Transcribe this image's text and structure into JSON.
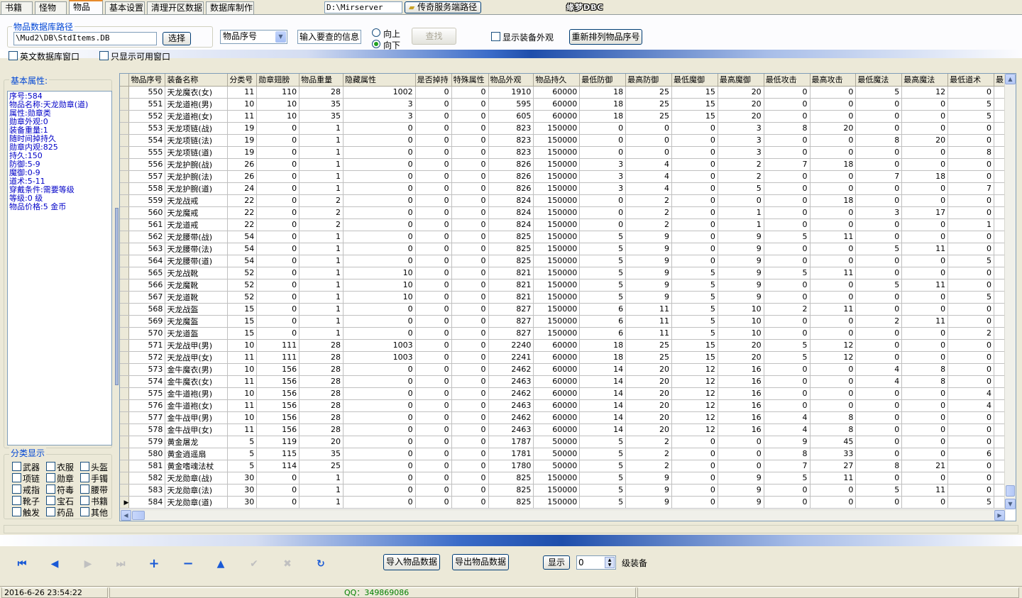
{
  "tabs": [
    "书籍",
    "怪物",
    "物品",
    "基本设置",
    "清理开区数据",
    "数据库制作"
  ],
  "active_tab": 2,
  "server_path": "D:\\Mirserver",
  "server_path_button": "传奇服务端路径",
  "logo_text": "缘梦DBC",
  "db_group_title": "物品数据库路径",
  "db_path": "\\Mud2\\DB\\StdItems.DB",
  "select_button": "选择",
  "search_field_select": "物品序号",
  "search_input_label": "输入要查的信息",
  "radio_up": "向上",
  "radio_down": "向下",
  "find_button": "查找",
  "show_appearance_label": "显示装备外观",
  "reorder_button": "重新排列物品序号",
  "english_db_label": "英文数据库窗口",
  "only_usable_label": "只显示可用窗口",
  "basic_props_title": "基本属性:",
  "props": [
    "序号:584",
    "物品名称:天龙勋章(道)",
    "属性:勋章类",
    "勋章外观:0",
    "装备重量:1",
    "随时间掉持久",
    "勋章内观:825",
    "持久:150",
    "防御:5-9",
    "魔御:0-9",
    "道术:5-11",
    "穿戴条件:需要等级",
    "等级:0 级",
    "物品价格:5 金币"
  ],
  "category_title": "分类显示",
  "categories": [
    "武器",
    "衣服",
    "头盔",
    "项链",
    "勋章",
    "手镯",
    "戒指",
    "符毒",
    "腰带",
    "靴子",
    "宝石",
    "书籍",
    "触发",
    "药品",
    "其他"
  ],
  "columns": [
    "物品序号",
    "装备名称",
    "分类号",
    "勋章翅膀",
    "物品重量",
    "隐藏属性",
    "是否掉持",
    "特殊属性",
    "物品外观",
    "物品持久",
    "最低防御",
    "最高防御",
    "最低魔御",
    "最高魔御",
    "最低攻击",
    "最高攻击",
    "最低魔法",
    "最高魔法",
    "最低道术",
    "最"
  ],
  "rows": [
    [
      "550",
      "天龙魔衣(女)",
      "11",
      "110",
      "28",
      "1002",
      "0",
      "0",
      "1910",
      "60000",
      "18",
      "25",
      "15",
      "20",
      "0",
      "0",
      "5",
      "12",
      "0"
    ],
    [
      "551",
      "天龙道袍(男)",
      "10",
      "10",
      "35",
      "3",
      "0",
      "0",
      "595",
      "60000",
      "18",
      "25",
      "15",
      "20",
      "0",
      "0",
      "0",
      "0",
      "5"
    ],
    [
      "552",
      "天龙道袍(女)",
      "11",
      "10",
      "35",
      "3",
      "0",
      "0",
      "605",
      "60000",
      "18",
      "25",
      "15",
      "20",
      "0",
      "0",
      "0",
      "0",
      "5"
    ],
    [
      "553",
      "天龙项链(战)",
      "19",
      "0",
      "1",
      "0",
      "0",
      "0",
      "823",
      "150000",
      "0",
      "0",
      "0",
      "3",
      "8",
      "20",
      "0",
      "0",
      "0"
    ],
    [
      "554",
      "天龙项链(法)",
      "19",
      "0",
      "1",
      "0",
      "0",
      "0",
      "823",
      "150000",
      "0",
      "0",
      "0",
      "3",
      "0",
      "0",
      "8",
      "20",
      "0"
    ],
    [
      "555",
      "天龙项链(道)",
      "19",
      "0",
      "1",
      "0",
      "0",
      "0",
      "823",
      "150000",
      "0",
      "0",
      "0",
      "3",
      "0",
      "0",
      "0",
      "0",
      "8"
    ],
    [
      "556",
      "天龙护腕(战)",
      "26",
      "0",
      "1",
      "0",
      "0",
      "0",
      "826",
      "150000",
      "3",
      "4",
      "0",
      "2",
      "7",
      "18",
      "0",
      "0",
      "0"
    ],
    [
      "557",
      "天龙护腕(法)",
      "26",
      "0",
      "1",
      "0",
      "0",
      "0",
      "826",
      "150000",
      "3",
      "4",
      "0",
      "2",
      "0",
      "0",
      "7",
      "18",
      "0"
    ],
    [
      "558",
      "天龙护腕(道)",
      "24",
      "0",
      "1",
      "0",
      "0",
      "0",
      "826",
      "150000",
      "3",
      "4",
      "0",
      "5",
      "0",
      "0",
      "0",
      "0",
      "7"
    ],
    [
      "559",
      "天龙战戒",
      "22",
      "0",
      "2",
      "0",
      "0",
      "0",
      "824",
      "150000",
      "0",
      "2",
      "0",
      "0",
      "0",
      "18",
      "0",
      "0",
      "0"
    ],
    [
      "560",
      "天龙魔戒",
      "22",
      "0",
      "2",
      "0",
      "0",
      "0",
      "824",
      "150000",
      "0",
      "2",
      "0",
      "1",
      "0",
      "0",
      "3",
      "17",
      "0"
    ],
    [
      "561",
      "天龙道戒",
      "22",
      "0",
      "2",
      "0",
      "0",
      "0",
      "824",
      "150000",
      "0",
      "2",
      "0",
      "1",
      "0",
      "0",
      "0",
      "0",
      "1"
    ],
    [
      "562",
      "天龙腰带(战)",
      "54",
      "0",
      "1",
      "0",
      "0",
      "0",
      "825",
      "150000",
      "5",
      "9",
      "0",
      "9",
      "5",
      "11",
      "0",
      "0",
      "0"
    ],
    [
      "563",
      "天龙腰带(法)",
      "54",
      "0",
      "1",
      "0",
      "0",
      "0",
      "825",
      "150000",
      "5",
      "9",
      "0",
      "9",
      "0",
      "0",
      "5",
      "11",
      "0"
    ],
    [
      "564",
      "天龙腰带(道)",
      "54",
      "0",
      "1",
      "0",
      "0",
      "0",
      "825",
      "150000",
      "5",
      "9",
      "0",
      "9",
      "0",
      "0",
      "0",
      "0",
      "5"
    ],
    [
      "565",
      "天龙战靴",
      "52",
      "0",
      "1",
      "10",
      "0",
      "0",
      "821",
      "150000",
      "5",
      "9",
      "5",
      "9",
      "5",
      "11",
      "0",
      "0",
      "0"
    ],
    [
      "566",
      "天龙魔靴",
      "52",
      "0",
      "1",
      "10",
      "0",
      "0",
      "821",
      "150000",
      "5",
      "9",
      "5",
      "9",
      "0",
      "0",
      "5",
      "11",
      "0"
    ],
    [
      "567",
      "天龙道靴",
      "52",
      "0",
      "1",
      "10",
      "0",
      "0",
      "821",
      "150000",
      "5",
      "9",
      "5",
      "9",
      "0",
      "0",
      "0",
      "0",
      "5"
    ],
    [
      "568",
      "天龙战盔",
      "15",
      "0",
      "1",
      "0",
      "0",
      "0",
      "827",
      "150000",
      "6",
      "11",
      "5",
      "10",
      "2",
      "11",
      "0",
      "0",
      "0"
    ],
    [
      "569",
      "天龙魔盔",
      "15",
      "0",
      "1",
      "0",
      "0",
      "0",
      "827",
      "150000",
      "6",
      "11",
      "5",
      "10",
      "0",
      "0",
      "2",
      "11",
      "0"
    ],
    [
      "570",
      "天龙道盔",
      "15",
      "0",
      "1",
      "0",
      "0",
      "0",
      "827",
      "150000",
      "6",
      "11",
      "5",
      "10",
      "0",
      "0",
      "0",
      "0",
      "2"
    ],
    [
      "571",
      "天龙战甲(男)",
      "10",
      "111",
      "28",
      "1003",
      "0",
      "0",
      "2240",
      "60000",
      "18",
      "25",
      "15",
      "20",
      "5",
      "12",
      "0",
      "0",
      "0"
    ],
    [
      "572",
      "天龙战甲(女)",
      "11",
      "111",
      "28",
      "1003",
      "0",
      "0",
      "2241",
      "60000",
      "18",
      "25",
      "15",
      "20",
      "5",
      "12",
      "0",
      "0",
      "0"
    ],
    [
      "573",
      "金牛魔衣(男)",
      "10",
      "156",
      "28",
      "0",
      "0",
      "0",
      "2462",
      "60000",
      "14",
      "20",
      "12",
      "16",
      "0",
      "0",
      "4",
      "8",
      "0"
    ],
    [
      "574",
      "金牛魔衣(女)",
      "11",
      "156",
      "28",
      "0",
      "0",
      "0",
      "2463",
      "60000",
      "14",
      "20",
      "12",
      "16",
      "0",
      "0",
      "4",
      "8",
      "0"
    ],
    [
      "575",
      "金牛道袍(男)",
      "10",
      "156",
      "28",
      "0",
      "0",
      "0",
      "2462",
      "60000",
      "14",
      "20",
      "12",
      "16",
      "0",
      "0",
      "0",
      "0",
      "4"
    ],
    [
      "576",
      "金牛道袍(女)",
      "11",
      "156",
      "28",
      "0",
      "0",
      "0",
      "2463",
      "60000",
      "14",
      "20",
      "12",
      "16",
      "0",
      "0",
      "0",
      "0",
      "4"
    ],
    [
      "577",
      "金牛战甲(男)",
      "10",
      "156",
      "28",
      "0",
      "0",
      "0",
      "2462",
      "60000",
      "14",
      "20",
      "12",
      "16",
      "4",
      "8",
      "0",
      "0",
      "0"
    ],
    [
      "578",
      "金牛战甲(女)",
      "11",
      "156",
      "28",
      "0",
      "0",
      "0",
      "2463",
      "60000",
      "14",
      "20",
      "12",
      "16",
      "4",
      "8",
      "0",
      "0",
      "0"
    ],
    [
      "579",
      "黄金屠龙",
      "5",
      "119",
      "20",
      "0",
      "0",
      "0",
      "1787",
      "50000",
      "5",
      "2",
      "0",
      "0",
      "9",
      "45",
      "0",
      "0",
      "0"
    ],
    [
      "580",
      "黄金逍遥扇",
      "5",
      "115",
      "35",
      "0",
      "0",
      "0",
      "1781",
      "50000",
      "5",
      "2",
      "0",
      "0",
      "8",
      "33",
      "0",
      "0",
      "6"
    ],
    [
      "581",
      "黄金嗜魂法杖",
      "5",
      "114",
      "25",
      "0",
      "0",
      "0",
      "1780",
      "50000",
      "5",
      "2",
      "0",
      "0",
      "7",
      "27",
      "8",
      "21",
      "0"
    ],
    [
      "582",
      "天龙勋章(战)",
      "30",
      "0",
      "1",
      "0",
      "0",
      "0",
      "825",
      "150000",
      "5",
      "9",
      "0",
      "9",
      "5",
      "11",
      "0",
      "0",
      "0"
    ],
    [
      "583",
      "天龙勋章(法)",
      "30",
      "0",
      "1",
      "0",
      "0",
      "0",
      "825",
      "150000",
      "5",
      "9",
      "0",
      "9",
      "0",
      "0",
      "5",
      "11",
      "0"
    ],
    [
      "584",
      "天龙勋章(道)",
      "30",
      "0",
      "1",
      "0",
      "0",
      "0",
      "825",
      "150000",
      "5",
      "9",
      "0",
      "9",
      "0",
      "0",
      "0",
      "0",
      "5"
    ]
  ],
  "import_button": "导入物品数据",
  "export_button": "导出物品数据",
  "show_button": "显示",
  "level_value": "0",
  "level_suffix": "级装备",
  "status_datetime": "2016-6-26 23:54:22",
  "status_qq": "QQ：349869086",
  "colors": {
    "accent": "#0046d5",
    "grid_text": "#000000",
    "prop_text": "#0000c8",
    "qq_text": "#008000"
  }
}
